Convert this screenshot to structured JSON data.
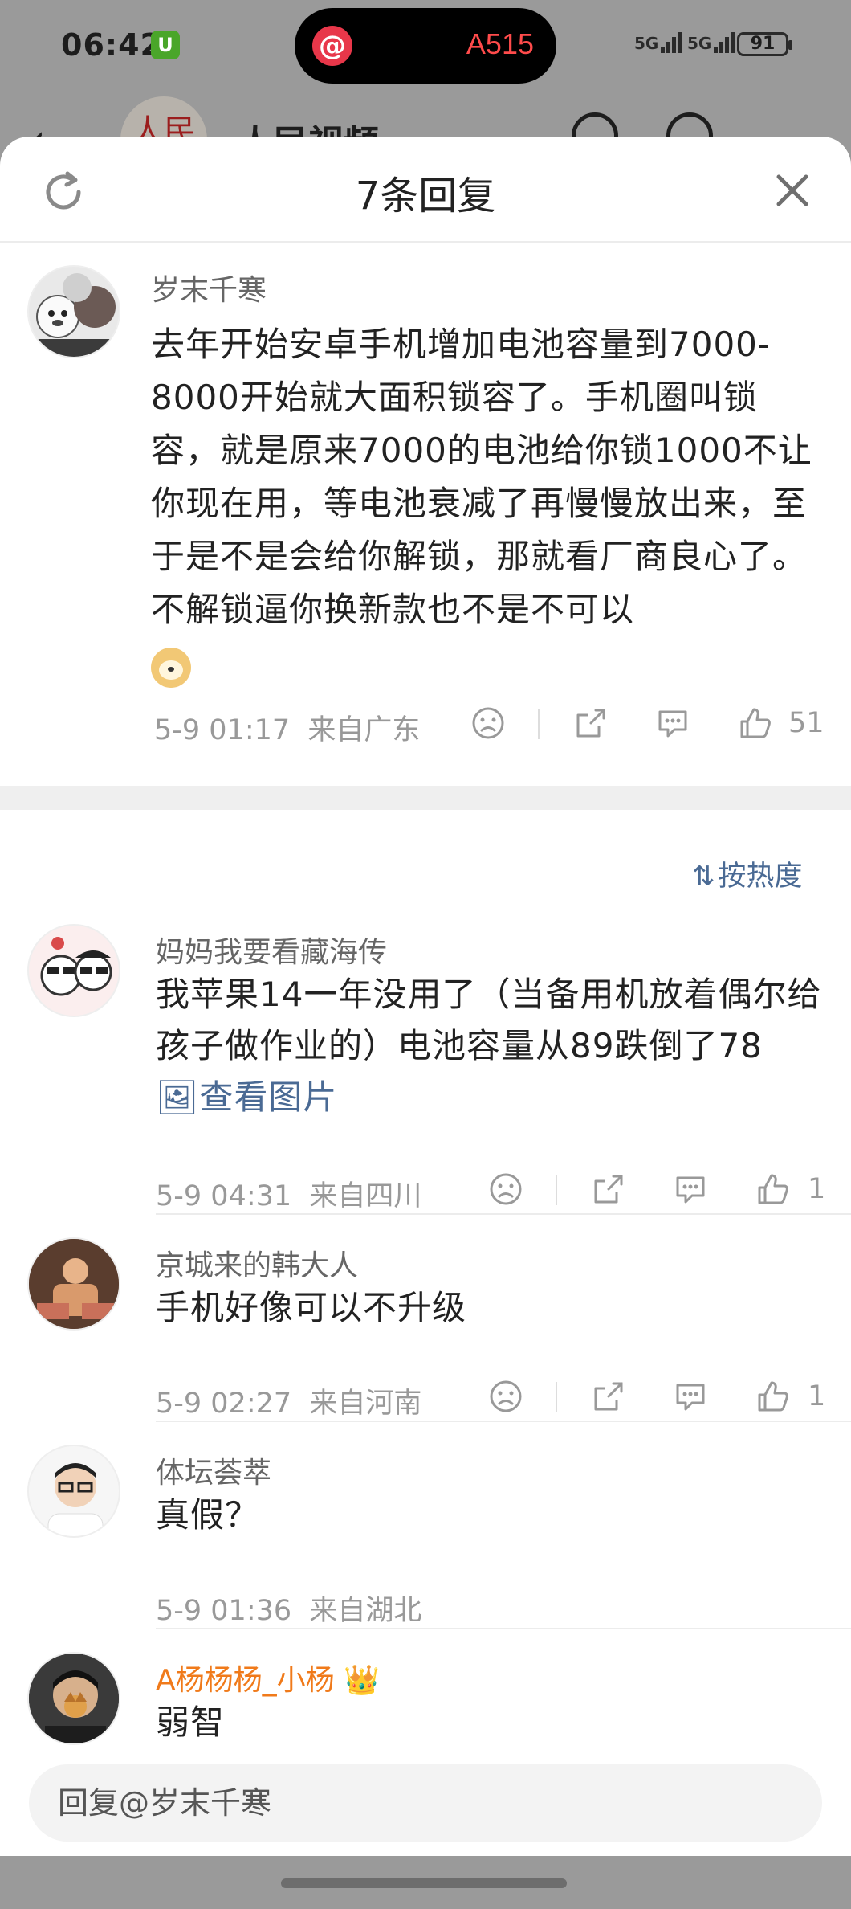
{
  "status_bar": {
    "time": "06:42",
    "island_text": "A515",
    "signal_1": "5G",
    "signal_2": "5G",
    "battery": "91"
  },
  "background_app": {
    "title": "人民视频",
    "logo_text": "人民"
  },
  "sheet": {
    "title": "7条回复",
    "refresh_icon": "refresh-icon",
    "close_icon": "close-icon"
  },
  "main_comment": {
    "username": "岁末千寒",
    "text": "去年开始安卓手机增加电池容量到7000-8000开始就大面积锁容了。手机圈叫锁容，就是原来7000的电池给你锁1000不让你现在用，等电池衰减了再慢慢放出来，至于是不是会给你解锁，那就看厂商良心了。不解锁逼你换新款也不是不可以",
    "time": "5-9 01:17",
    "location": "来自广东",
    "likes": "51"
  },
  "sort": {
    "label": "按热度",
    "icon": "sort-icon"
  },
  "replies": [
    {
      "username": "妈妈我要看藏海传",
      "text": "我苹果14一年没用了（当备用机放着偶尔给孩子做作业的）电池容量从89跌倒了78",
      "link": "查看图片",
      "time": "5-9 04:31",
      "location": "来自四川",
      "likes": "1"
    },
    {
      "username": "京城来的韩大人",
      "text": "手机好像可以不升级",
      "time": "5-9 02:27",
      "location": "来自河南",
      "likes": "1"
    },
    {
      "username": "体坛荟萃",
      "text": "真假？",
      "time": "5-9 01:36",
      "location": "来自湖北"
    },
    {
      "username": "A杨杨杨_小杨",
      "text": "弱智",
      "username_color": "#f07a1a"
    }
  ],
  "reply_input": {
    "placeholder": "回复@岁末千寒"
  }
}
